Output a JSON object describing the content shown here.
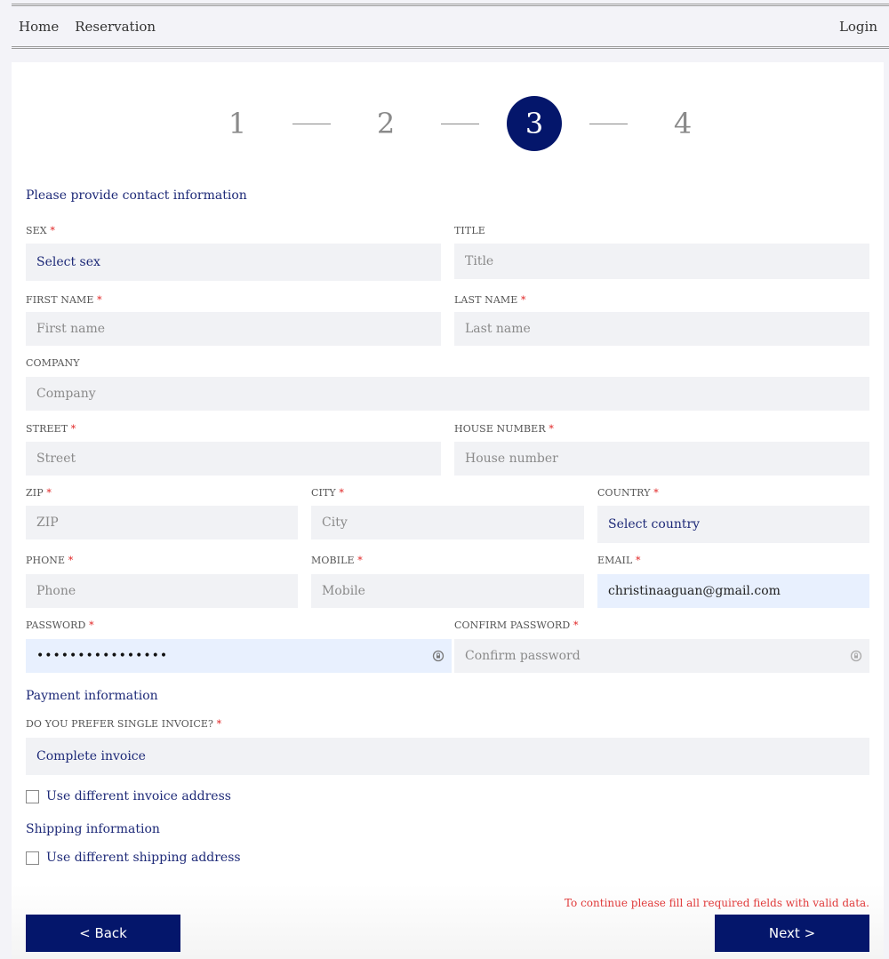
{
  "nav": {
    "home": "Home",
    "reservation": "Reservation",
    "login": "Login"
  },
  "stepper": {
    "steps": [
      "1",
      "2",
      "3",
      "4"
    ],
    "current_step": 3
  },
  "contact": {
    "title": "Please provide contact information",
    "sex": {
      "label": "SEX",
      "value": "Select sex"
    },
    "title_field": {
      "label": "TITLE",
      "placeholder": "Title"
    },
    "first_name": {
      "label": "FIRST NAME",
      "placeholder": "First name"
    },
    "last_name": {
      "label": "LAST NAME",
      "placeholder": "Last name"
    },
    "company": {
      "label": "COMPANY",
      "placeholder": "Company"
    },
    "street": {
      "label": "STREET",
      "placeholder": "Street"
    },
    "house_number": {
      "label": "HOUSE NUMBER",
      "placeholder": "House number"
    },
    "zip": {
      "label": "ZIP",
      "placeholder": "ZIP"
    },
    "city": {
      "label": "CITY",
      "placeholder": "City"
    },
    "country": {
      "label": "COUNTRY",
      "value": "Select country"
    },
    "phone": {
      "label": "PHONE",
      "placeholder": "Phone"
    },
    "mobile": {
      "label": "MOBILE",
      "placeholder": "Mobile"
    },
    "email": {
      "label": "EMAIL",
      "value": "christinaaguan@gmail.com"
    },
    "password": {
      "label": "PASSWORD",
      "value": "••••••••••••••••"
    },
    "confirm_password": {
      "label": "CONFIRM PASSWORD",
      "placeholder": "Confirm password"
    },
    "required_mark": "*"
  },
  "payment": {
    "title": "Payment information",
    "single_invoice": {
      "label": "DO YOU PREFER SINGLE INVOICE?",
      "value": "Complete invoice"
    },
    "different_invoice_address": {
      "label": "Use different invoice address",
      "checked": false
    }
  },
  "shipping": {
    "title": "Shipping information",
    "different_shipping_address": {
      "label": "Use different shipping address",
      "checked": false
    }
  },
  "footer": {
    "error": "To continue please fill all required fields with valid data.",
    "back": "< Back",
    "next": "Next >"
  },
  "colors": {
    "primary": "#04166b",
    "error": "#e03a3a",
    "input_bg": "#f1f2f5",
    "autofill_bg": "#e8f0fe"
  }
}
